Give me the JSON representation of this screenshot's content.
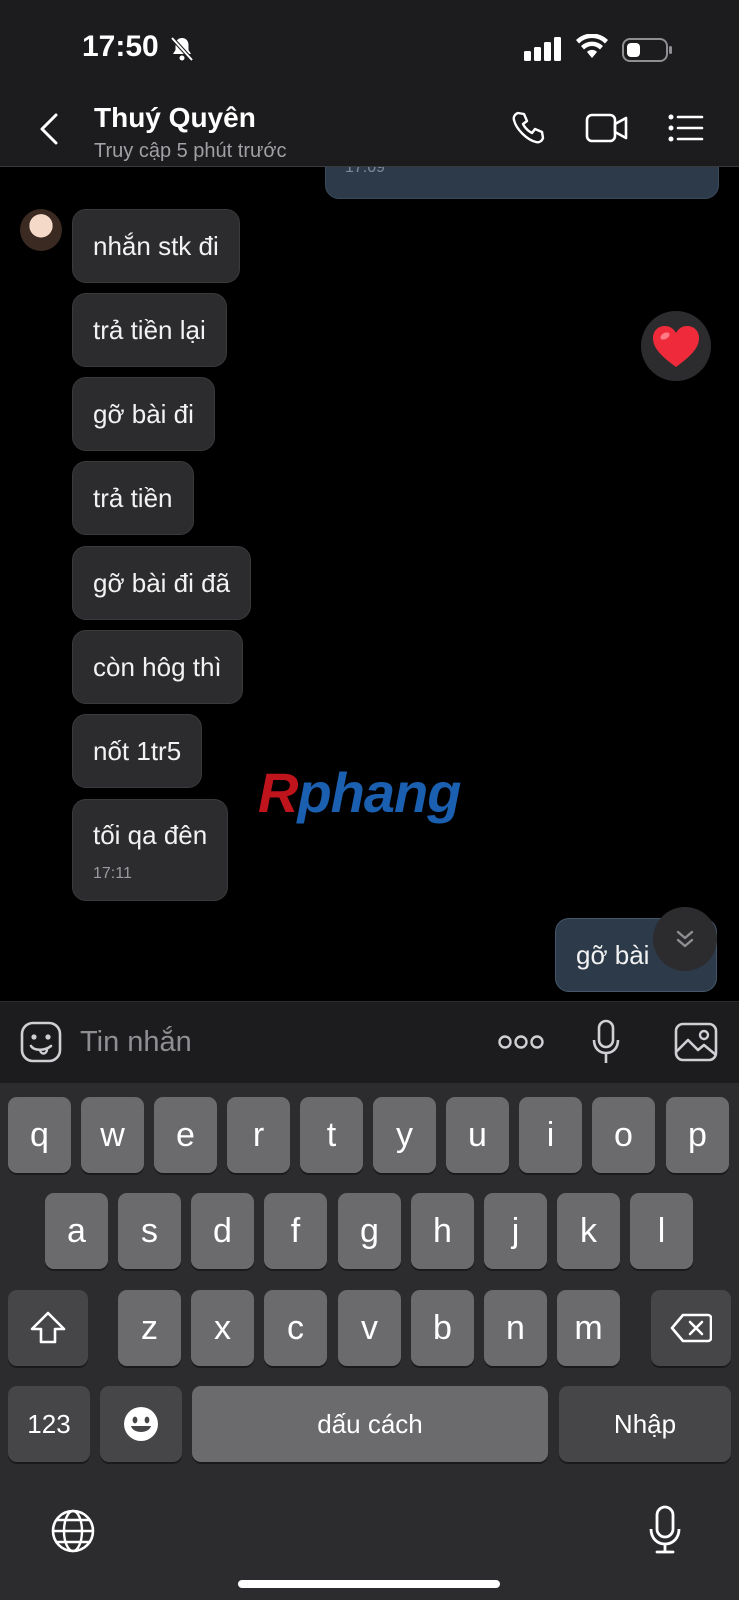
{
  "status_bar": {
    "time": "17:50"
  },
  "header": {
    "contact_name": "Thuý Quyên",
    "last_seen": "Truy cập 5 phút trước"
  },
  "chat": {
    "previous_message_time": "17:09",
    "incoming_messages": [
      "nhắn stk đi",
      "trả tiền lại",
      "gỡ bài đi",
      "trả tiền",
      "gỡ bài đi đã",
      "còn hôg thì",
      "nốt 1tr5",
      "tối qa đên"
    ],
    "last_incoming_time": "17:11",
    "reaction_emoji": "❤️",
    "outgoing_message": "gỡ bài",
    "watermark_first": "R",
    "watermark_rest": "phang"
  },
  "composer": {
    "placeholder": "Tin nhắn"
  },
  "keyboard": {
    "row1": [
      "q",
      "w",
      "e",
      "r",
      "t",
      "y",
      "u",
      "i",
      "o",
      "p"
    ],
    "row2": [
      "a",
      "s",
      "d",
      "f",
      "g",
      "h",
      "j",
      "k",
      "l"
    ],
    "row3": [
      "z",
      "x",
      "c",
      "v",
      "b",
      "n",
      "m"
    ],
    "numbers_key": "123",
    "space_key": "dấu cách",
    "return_key": "Nhập"
  },
  "colors": {
    "incoming_bubble": "#2c2c2e",
    "outgoing_bubble": "#2c3a4a",
    "background": "#000000"
  }
}
